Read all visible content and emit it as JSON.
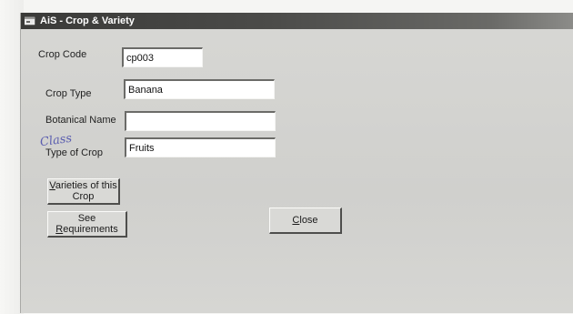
{
  "window": {
    "title": "AiS - Crop & Variety"
  },
  "fields": {
    "crop_code": {
      "label": "Crop Code",
      "value": "cp003"
    },
    "crop_type": {
      "label": "Crop Type",
      "value": "Banana"
    },
    "botanical_name": {
      "label": "Botanical Name",
      "value": ""
    },
    "type_of_crop": {
      "label": "Type of Crop",
      "value": "Fruits"
    }
  },
  "annotation": {
    "handwritten_note": "Class"
  },
  "buttons": {
    "varieties": {
      "line1": "Varieties of this",
      "line2": "Crop"
    },
    "requirements": {
      "line1": "See",
      "line2": "Requirements"
    },
    "close": {
      "label": "Close"
    }
  }
}
